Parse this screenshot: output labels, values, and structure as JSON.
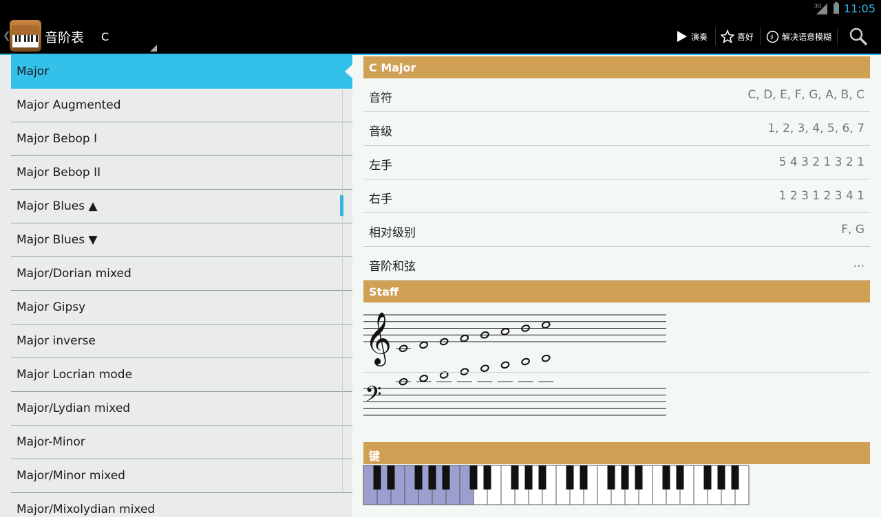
{
  "status": {
    "network": "3G",
    "time": "11:05"
  },
  "actionbar": {
    "title": "音阶表",
    "key": "C",
    "actions": [
      {
        "label": "演奏",
        "icon": "play-icon"
      },
      {
        "label": "喜好",
        "icon": "star-icon"
      },
      {
        "label": "解决语意模糊",
        "icon": "disambiguate-icon"
      }
    ],
    "search_icon": "search-icon"
  },
  "scales": [
    "Major",
    "Major Augmented",
    "Major Bebop I",
    "Major Bebop II",
    "Major Blues ▲",
    "Major Blues ▼",
    "Major/Dorian mixed",
    "Major Gipsy",
    "Major inverse",
    "Major Locrian mode",
    "Major/Lydian mixed",
    "Major-Minor",
    "Major/Minor mixed",
    "Major/Mixolydian mixed"
  ],
  "selected_index": 0,
  "detail": {
    "header": "C Major",
    "rows": [
      {
        "label": "音符",
        "value": "C, D, E, F, G, A, B, C"
      },
      {
        "label": "音级",
        "value": "1, 2, 3, 4, 5, 6, 7"
      },
      {
        "label": "左手",
        "value": "5 4 3 2 1 3 2 1"
      },
      {
        "label": "右手",
        "value": "1 2 3 1 2 3 4 1"
      },
      {
        "label": "相对级别",
        "value": "F, G"
      },
      {
        "label": "音阶和弦",
        "value": "..."
      }
    ],
    "staff_header": "Staff",
    "keys_header": "键"
  },
  "colors": {
    "accent": "#33b5e5",
    "selected": "#33c1ea",
    "section_header": "#d0a055",
    "highlight_key": "#9b9fd0"
  },
  "treble_steps": [
    -2,
    -1,
    0,
    1,
    2,
    3,
    4,
    5
  ],
  "bass_steps": [
    10,
    11,
    12,
    13,
    14,
    15,
    16,
    17
  ],
  "keyboard": {
    "white_keys": 28,
    "highlighted_white_keys": 8
  }
}
